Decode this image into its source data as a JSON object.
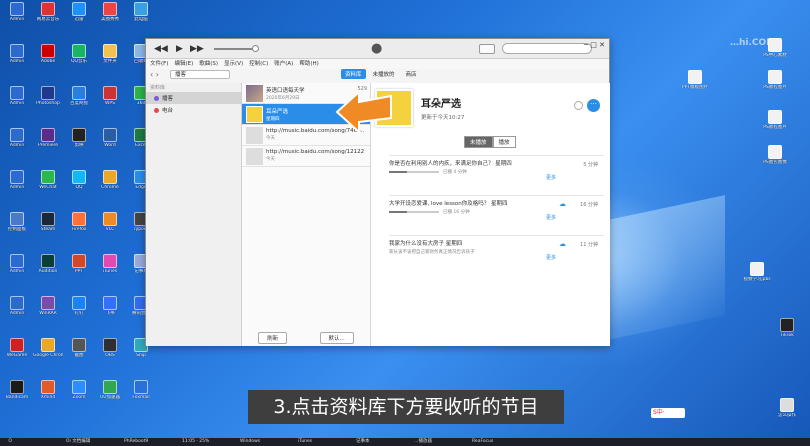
{
  "colors": {
    "accent": "#2a8ee8",
    "arrow": "#f08a24",
    "caption_bg": "#3e3e3e"
  },
  "desktop": {
    "left_icons": [
      {
        "label": "Admin",
        "color": "#2b6ad0"
      },
      {
        "label": "网易云音乐",
        "color": "#d33"
      },
      {
        "label": "迅雷",
        "color": "#1e90ff"
      },
      {
        "label": "美图秀秀",
        "color": "#e44"
      },
      {
        "label": "此电脑",
        "color": "#3aa0e0"
      },
      {
        "label": "Admin",
        "color": "#2b6ad0"
      },
      {
        "label": "Adobe",
        "color": "#c00"
      },
      {
        "label": "QQ音乐",
        "color": "#19b464"
      },
      {
        "label": "文件夹",
        "color": "#f2c14e"
      },
      {
        "label": "回收站",
        "color": "#8fb8e6"
      },
      {
        "label": "Admin",
        "color": "#2b6ad0"
      },
      {
        "label": "Photoshop",
        "color": "#1f3a8a"
      },
      {
        "label": "百度网盘",
        "color": "#2a7de1"
      },
      {
        "label": "WPS",
        "color": "#c33"
      },
      {
        "label": "360",
        "color": "#2eb34a"
      },
      {
        "label": "Admin",
        "color": "#2b6ad0"
      },
      {
        "label": "Premiere",
        "color": "#5a2b91"
      },
      {
        "label": "剪映",
        "color": "#222"
      },
      {
        "label": "Word",
        "color": "#2a5caa"
      },
      {
        "label": "Excel",
        "color": "#1e7b45"
      },
      {
        "label": "Admin",
        "color": "#2b6ad0"
      },
      {
        "label": "WeChat",
        "color": "#2db84d"
      },
      {
        "label": "QQ",
        "color": "#12b7f5"
      },
      {
        "label": "Chrome",
        "color": "#e9a82a"
      },
      {
        "label": "Edge",
        "color": "#2a8ee8"
      },
      {
        "label": "控制面板",
        "color": "#4a7bc8"
      },
      {
        "label": "Steam",
        "color": "#1b2838"
      },
      {
        "label": "Firefox",
        "color": "#ff7139"
      },
      {
        "label": "VLC",
        "color": "#f08a24"
      },
      {
        "label": "Typora",
        "color": "#444"
      },
      {
        "label": "Admin",
        "color": "#2b6ad0"
      },
      {
        "label": "Audition",
        "color": "#0b3d3a"
      },
      {
        "label": "PPT",
        "color": "#d24726"
      },
      {
        "label": "iTunes",
        "color": "#e24ab0"
      },
      {
        "label": "记事本",
        "color": "#9ad"
      },
      {
        "label": "Admin",
        "color": "#2b6ad0"
      },
      {
        "label": "WinRAR",
        "color": "#7a4ab0"
      },
      {
        "label": "钉钉",
        "color": "#1a82fb"
      },
      {
        "label": "飞书",
        "color": "#3370ff"
      },
      {
        "label": "腾讯会议",
        "color": "#2f6ef2"
      },
      {
        "label": "WeGame",
        "color": "#c22"
      },
      {
        "label": "Google Chrome",
        "color": "#e9a82a"
      },
      {
        "label": "截图",
        "color": "#555"
      },
      {
        "label": "OBS",
        "color": "#302e31"
      },
      {
        "label": "Snip",
        "color": "#3ab"
      },
      {
        "label": "Bandicam",
        "color": "#1a1a1a"
      },
      {
        "label": "Xmind",
        "color": "#e05c2b"
      },
      {
        "label": "Zoom",
        "color": "#2d8cff"
      },
      {
        "label": "UU加速器",
        "color": "#2fa84f"
      },
      {
        "label": "Foxmail",
        "color": "#2672d9"
      }
    ],
    "right_icons": [
      {
        "label": "PS中心素材",
        "color": "#f2f2f2"
      },
      {
        "label": "PPT模板图片",
        "color": "#f2f2f2"
      },
      {
        "label": "PS教程图片",
        "color": "#f2f2f2"
      },
      {
        "label": "PS教程图片",
        "color": "#f2f2f2"
      },
      {
        "label": "PS图包图像",
        "color": "#f2f2f2"
      },
      {
        "label": "视频学习jpbs",
        "color": "#f2f2f2"
      },
      {
        "label": "TikTok",
        "color": "#222"
      },
      {
        "label": "怎么操作",
        "color": "#ddd"
      }
    ]
  },
  "itunes": {
    "search_placeholder": "",
    "menu": [
      "文件(F)",
      "编辑(E)",
      "歌曲(S)",
      "显示(V)",
      "控制(C)",
      "账户(A)",
      "帮助(H)"
    ],
    "tabs": [
      {
        "label": "资料库",
        "active": true
      },
      {
        "label": "未播放的",
        "active": false
      },
      {
        "label": "商店",
        "active": false
      }
    ],
    "media_select": "播客",
    "sidebar": {
      "heading": "资料库",
      "items": [
        {
          "label": "播客",
          "selected": true,
          "dot": "purple"
        },
        {
          "label": "电台",
          "selected": false,
          "dot": "red"
        }
      ]
    },
    "podcasts": [
      {
        "title": "英语口语每天学",
        "sub": "2020年6月29日",
        "count": "529",
        "selected": false
      },
      {
        "title": "耳朵严选",
        "sub": "星期四",
        "count": "",
        "selected": true
      },
      {
        "title": "http://music.baidu.com/song/7466...",
        "sub": "今天",
        "count": "",
        "selected": false
      },
      {
        "title": "http://music.baidu.com/song/12122...",
        "sub": "今天",
        "count": "",
        "selected": false
      }
    ],
    "list_buttons": [
      "刷新",
      "默认..."
    ],
    "detail": {
      "title": "耳朵严选",
      "updated": "更新于今天10:27",
      "segments": [
        {
          "label": "未播放",
          "active": true
        },
        {
          "label": "播放",
          "active": false
        }
      ],
      "more_label": "更多",
      "episodes": [
        {
          "title": "你是否在利用别人的内疚，来满足你自己？  星期四",
          "prog": "已播 4 分钟",
          "desc": "",
          "duration": "5 分钟",
          "cloud": false,
          "has_bar": true
        },
        {
          "title": "大学开设恋爱课, love lesson你及格吗？  星期四",
          "prog": "已播 16 分钟",
          "desc": "",
          "duration": "16 分钟",
          "cloud": true,
          "has_bar": true
        },
        {
          "title": "我家为什么没有大房子  星期四",
          "prog": "",
          "desc": "家长该不该把自己家财务真正情况告诉孩子",
          "duration": "11 分钟",
          "cloud": true,
          "has_bar": false
        }
      ]
    }
  },
  "caption": "3.点击资料库下方要收听的节目",
  "watermark": "…hi.COM",
  "tray_badge": "S中·",
  "taskbar": [
    "Ｏ",
    "Oi 文档编辑",
    "PhReboot9",
    "11:05 · 25%",
    "Windows",
    "iTunes",
    "记事本",
    "…播放器",
    "ReaFocus"
  ]
}
